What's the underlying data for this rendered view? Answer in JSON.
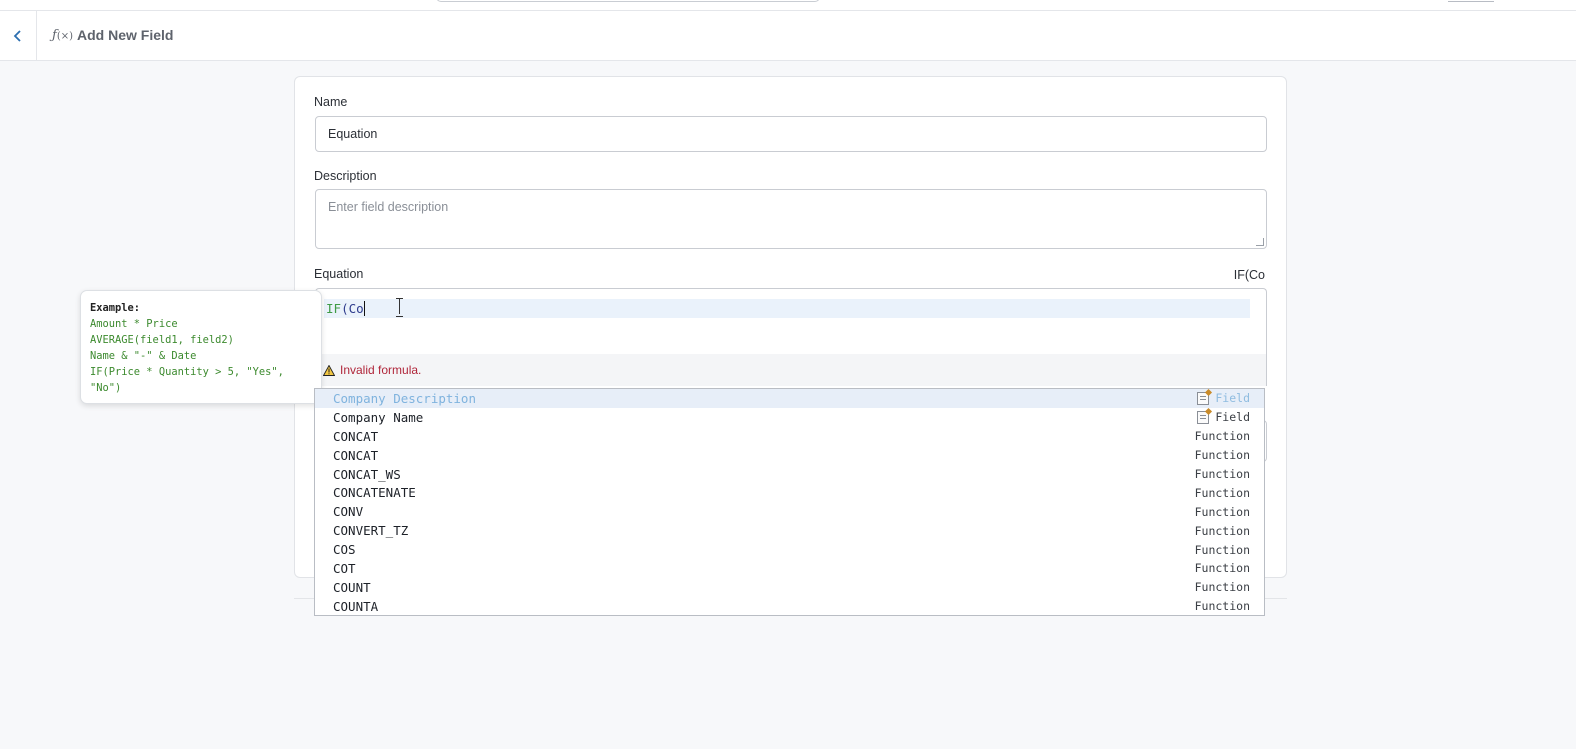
{
  "header": {
    "back_label": "‹",
    "fx_symbol": "ƒ",
    "fx_sub": "(×)",
    "title": "Add New Field"
  },
  "form": {
    "name_label": "Name",
    "name_value": "Equation",
    "description_label": "Description",
    "description_placeholder": "Enter field description",
    "equation_label": "Equation",
    "equation_preview": "IF(Co",
    "equation_code": {
      "keyword": "IF",
      "rest": "(Co"
    },
    "error_icon": "⚠",
    "error_text": "Invalid formula."
  },
  "tooltip": {
    "heading": "Example:",
    "examples": [
      "Amount * Price",
      "AVERAGE(field1, field2)",
      "Name & \"-\" & Date",
      "IF(Price * Quantity > 5, \"Yes\",",
      "\"No\")"
    ]
  },
  "autocomplete": {
    "items": [
      {
        "label": "Company Description",
        "type": "Field",
        "icon": "document-icon"
      },
      {
        "label": "Company Name",
        "type": "Field",
        "icon": "document-icon"
      },
      {
        "label": "CONCAT",
        "type": "Function"
      },
      {
        "label": "CONCAT",
        "type": "Function"
      },
      {
        "label": "CONCAT_WS",
        "type": "Function"
      },
      {
        "label": "CONCATENATE",
        "type": "Function"
      },
      {
        "label": "CONV",
        "type": "Function"
      },
      {
        "label": "CONVERT_TZ",
        "type": "Function"
      },
      {
        "label": "COS",
        "type": "Function"
      },
      {
        "label": "COT",
        "type": "Function"
      },
      {
        "label": "COUNT",
        "type": "Function"
      },
      {
        "label": "COUNTA",
        "type": "Function"
      }
    ]
  },
  "colors": {
    "accent": "#2c6fb0",
    "error": "#b0263a",
    "code_keyword": "#3e9b45",
    "selection": "#e7eef8"
  }
}
